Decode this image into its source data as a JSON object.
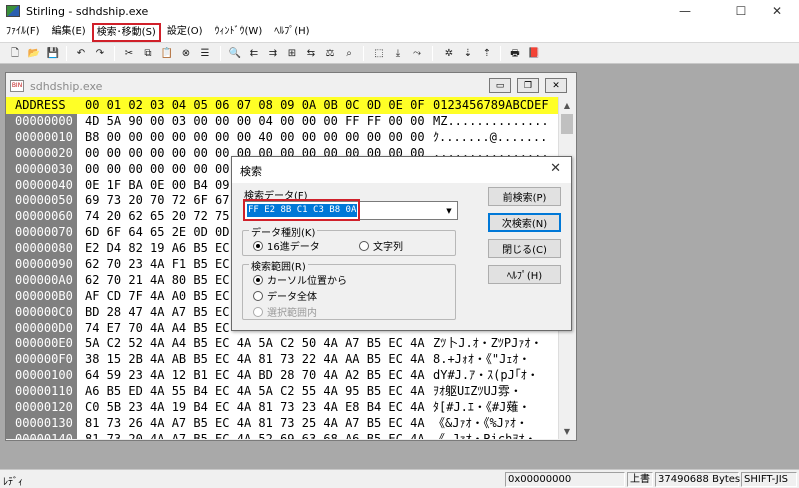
{
  "window": {
    "title": "Stirling - sdhdship.exe",
    "minimize": "—",
    "maximize": "☐",
    "close": "✕"
  },
  "menu": [
    {
      "label": "ﾌｧｲﾙ(F)"
    },
    {
      "label": "編集(E)"
    },
    {
      "label": "検索･移動(S)",
      "highlighted": true
    },
    {
      "label": "設定(O)"
    },
    {
      "label": "ｳｨﾝﾄﾞｳ(W)"
    },
    {
      "label": "ﾍﾙﾌﾟ(H)"
    }
  ],
  "toolbar": [
    {
      "icon": "new-file-icon",
      "glyph": "🗋"
    },
    {
      "icon": "open-folder-icon",
      "glyph": "📂"
    },
    {
      "icon": "save-icon",
      "glyph": "💾"
    },
    {
      "icon": "undo-icon",
      "glyph": "↶"
    },
    {
      "icon": "redo-icon",
      "glyph": "↷"
    },
    {
      "icon": "cut-icon",
      "glyph": "✂"
    },
    {
      "icon": "copy-icon",
      "glyph": "⧉"
    },
    {
      "icon": "paste-icon",
      "glyph": "📋"
    },
    {
      "icon": "delete-icon",
      "glyph": "⊗"
    },
    {
      "icon": "insert-icon",
      "glyph": "☰"
    },
    {
      "icon": "find-icon",
      "glyph": "🔍"
    },
    {
      "icon": "find-prev-icon",
      "glyph": "⇇"
    },
    {
      "icon": "find-next-icon",
      "glyph": "⇉"
    },
    {
      "icon": "find-hex-icon",
      "glyph": "⊞"
    },
    {
      "icon": "replace-icon",
      "glyph": "⇆"
    },
    {
      "icon": "compare-icon",
      "glyph": "⚖"
    },
    {
      "icon": "find-text-icon",
      "glyph": "⌕"
    },
    {
      "icon": "goto-icon",
      "glyph": "⬚"
    },
    {
      "icon": "goto-down-icon",
      "glyph": "⤓"
    },
    {
      "icon": "goto-right-icon",
      "glyph": "⤳"
    },
    {
      "icon": "bookmark-icon",
      "glyph": "✲"
    },
    {
      "icon": "bookmark-down-icon",
      "glyph": "⇣"
    },
    {
      "icon": "bookmark-up-icon",
      "glyph": "⇡"
    },
    {
      "icon": "print-icon",
      "glyph": "🖶"
    },
    {
      "icon": "help-book-icon",
      "glyph": "📕"
    }
  ],
  "child_window": {
    "title": "sdhdship.exe",
    "icon_text": "BIN"
  },
  "hex": {
    "header_address": "ADDRESS",
    "header_columns": "00 01 02 03 04 05 06 07 08 09 0A 0B 0C 0D 0E 0F",
    "header_ascii": "0123456789ABCDEF",
    "rows": [
      {
        "addr": "00000000",
        "bytes": "4D 5A 90 00 03 00 00 00 04 00 00 00 FF FF 00 00",
        "ascii": "MZ.............."
      },
      {
        "addr": "00000010",
        "bytes": "B8 00 00 00 00 00 00 00 40 00 00 00 00 00 00 00",
        "ascii": "ｸ.......@......."
      },
      {
        "addr": "00000020",
        "bytes": "00 00 00 00 00 00 00 00 00 00 00 00 00 00 00 00",
        "ascii": "................"
      },
      {
        "addr": "00000030",
        "bytes": "00 00 00 00 00 00 00 00 00 00 00 00 00 00 00 00",
        "ascii": "................"
      },
      {
        "addr": "00000040",
        "bytes": "0E 1F BA 0E 00 B4 09",
        "ascii": ""
      },
      {
        "addr": "00000050",
        "bytes": "69 73 20 70 72 6F 67",
        "ascii": ""
      },
      {
        "addr": "00000060",
        "bytes": "74 20 62 65 20 72 75",
        "ascii": ""
      },
      {
        "addr": "00000070",
        "bytes": "6D 6F 64 65 2E 0D 0D",
        "ascii": ""
      },
      {
        "addr": "00000080",
        "bytes": "E2 D4 82 19 A6 B5 EC",
        "ascii": ""
      },
      {
        "addr": "00000090",
        "bytes": "62 70 23 4A F1 B5 EC",
        "ascii": ""
      },
      {
        "addr": "000000A0",
        "bytes": "62 70 21 4A 80 B5 EC",
        "ascii": ""
      },
      {
        "addr": "000000B0",
        "bytes": "AF CD 7F 4A A0 B5 EC",
        "ascii": ""
      },
      {
        "addr": "000000C0",
        "bytes": "BD 28 47 4A A7 B5 EC",
        "ascii": ""
      },
      {
        "addr": "000000D0",
        "bytes": "74 E7 70 4A A4 B5 EC",
        "ascii": ""
      },
      {
        "addr": "000000E0",
        "bytes": "5A C2 52 4A A4 B5 EC 4A 5A C2 50 4A A7 B5 EC 4A",
        "ascii": "Zﾂ卜J.ｵ・ZﾂPJｧｵ・"
      },
      {
        "addr": "000000F0",
        "bytes": "38 15 2B 4A AB B5 EC 4A 81 73 22 4A AA B5 EC 4A",
        "ascii": "8.+Jｫｵ・《\"Jｪｵ・"
      },
      {
        "addr": "00000100",
        "bytes": "64 59 23 4A 12 B1 EC 4A BD 28 70 4A A2 B5 EC 4A",
        "ascii": "dY#J.ｱ・ｽ(pJ｢ｵ・"
      },
      {
        "addr": "00000110",
        "bytes": "A6 B5 ED 4A 55 B4 EC 4A 5A C2 55 4A 95 B5 EC 4A",
        "ascii": "ｦｵ躯UｴZﾂUJ雰・"
      },
      {
        "addr": "00000120",
        "bytes": "C0 5B 23 4A 19 B4 EC 4A 81 73 23 4A E8 B4 EC 4A",
        "ascii": "ﾀ[#J.ｴ・《#J薙・"
      },
      {
        "addr": "00000130",
        "bytes": "81 73 26 4A A7 B5 EC 4A 81 73 25 4A A7 B5 EC 4A",
        "ascii": "《&Jｧｵ・《%Jｧｵ・"
      },
      {
        "addr": "00000140",
        "bytes": "81 73 20 4A A7 B5 EC 4A 52 69 63 68 A6 B5 EC 4A",
        "ascii": "《 Jｧｵ・Richｦｵ・"
      }
    ]
  },
  "dialog": {
    "title": "検索",
    "close": "✕",
    "search_data_label": "検索データ(F)",
    "search_value": "FF E2 8B C1 C3 B8 0A",
    "data_type_group": "データ種別(K)",
    "type_hex": "16進データ",
    "type_string": "文字列",
    "range_group": "検索範囲(R)",
    "range_from_cursor": "カーソル位置から",
    "range_all": "データ全体",
    "range_selection": "選択範囲内",
    "btn_prev": "前検索(P)",
    "btn_next": "次検索(N)",
    "btn_close": "閉じる(C)",
    "btn_help": "ﾍﾙﾌﾟ(H)"
  },
  "status": {
    "ready": "ﾚﾃﾞｨ",
    "address": "0x00000000",
    "mode": "上書",
    "size": "37490688 Bytes",
    "encoding": "SHIFT-JIS"
  },
  "colors": {
    "header_yellow": "#ffff26",
    "address_gray": "#808080",
    "highlight_red": "#d0202a",
    "selection_blue": "#0078d7"
  }
}
